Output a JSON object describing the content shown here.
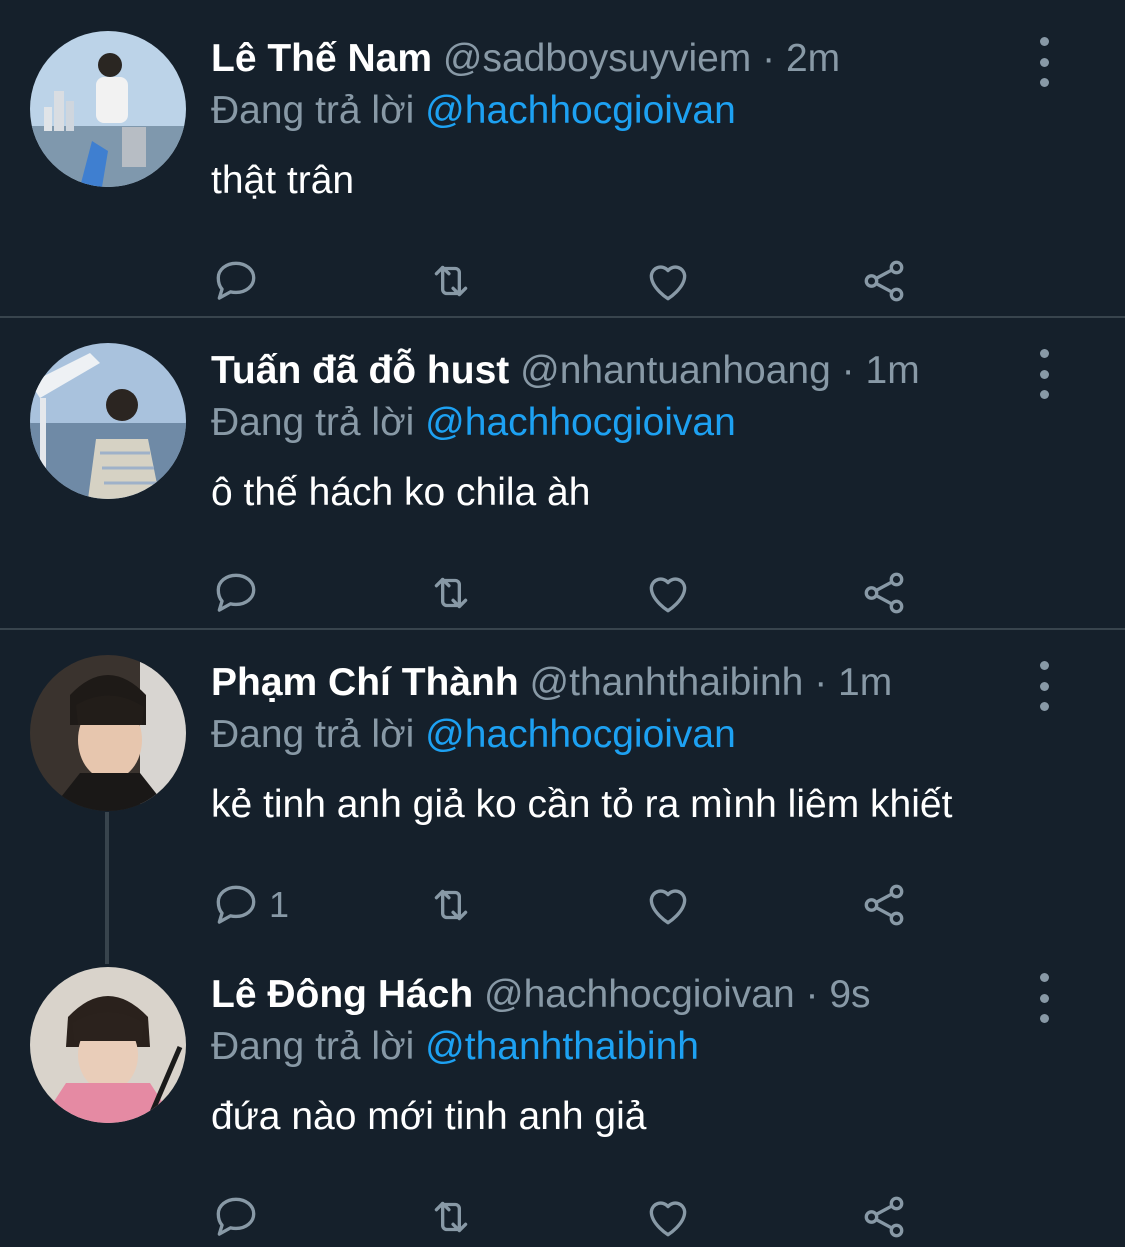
{
  "colors": {
    "background": "#15202b",
    "secondary_text": "#8899a6",
    "link": "#1da1f2",
    "divider": "#38444d"
  },
  "tweets": [
    {
      "name": "Lê Thế Nam",
      "handle": "@sadboysuyviem",
      "separator": "·",
      "time": "2m",
      "reply_prefix": "Đang trả lời",
      "reply_to": "@hachhocgioivan",
      "text": "thật trân",
      "reply_count": ""
    },
    {
      "name": "Tuấn đã đỗ hust",
      "handle": "@nhantuanhoang",
      "separator": "·",
      "time": "1m",
      "reply_prefix": "Đang trả lời",
      "reply_to": "@hachhocgioivan",
      "text": "ô thế hách ko chila àh",
      "reply_count": ""
    },
    {
      "name": "Phạm Chí Thành",
      "handle": "@thanhthaibinh",
      "separator": "·",
      "time": "1m",
      "reply_prefix": "Đang trả lời",
      "reply_to": "@hachhocgioivan",
      "text": "kẻ tinh anh giả ko cần tỏ ra mình liêm khiết",
      "reply_count": "1"
    },
    {
      "name": "Lê Đông Hách",
      "handle": "@hachhocgioivan",
      "separator": "·",
      "time": "9s",
      "reply_prefix": "Đang trả lời",
      "reply_to": "@thanhthaibinh",
      "text": "đứa nào mới tinh anh giả",
      "reply_count": ""
    }
  ],
  "icons": {
    "reply": "reply-icon",
    "retweet": "retweet-icon",
    "like": "heart-icon",
    "share": "share-icon",
    "more": "more-vertical-icon"
  }
}
